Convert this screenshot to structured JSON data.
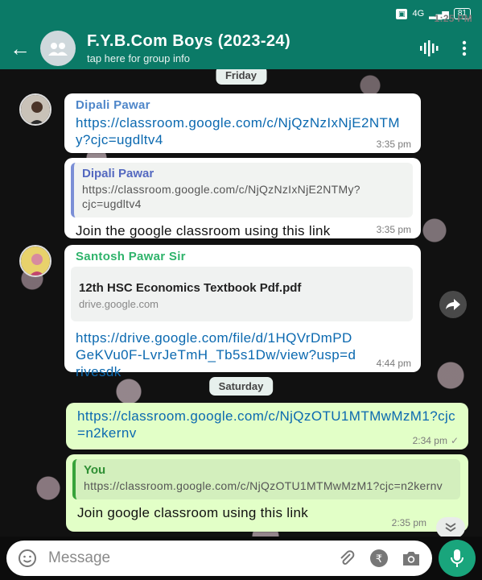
{
  "status_bar": {
    "time": "1:25 PM",
    "network": "4G",
    "battery": "81"
  },
  "header": {
    "title": "F.Y.B.Com Boys (2023-24)",
    "subtitle": "tap here for group info"
  },
  "dates": {
    "first": "Friday",
    "second": "Saturday"
  },
  "messages": [
    {
      "sender": "Dipali Pawar",
      "link": "https://classroom.google.com/c/NjQzNzIxNjE2NTMy?cjc=ugdltv4",
      "time": "3:35 pm"
    },
    {
      "quote_name": "Dipali Pawar",
      "quote_text": "https://classroom.google.com/c/NjQzNzIxNjE2NTMy?cjc=ugdltv4",
      "text": "Join the google classroom using this link",
      "time": "3:35 pm"
    },
    {
      "sender": "Santosh Pawar Sir",
      "doc_title": "12th HSC Economics Textbook Pdf.pdf",
      "doc_domain": "drive.google.com",
      "link": "https://drive.google.com/file/d/1HQVrDmPDGeKVu0F-LvrJeTmH_Tb5s1Dw/view?usp=drivesdk",
      "time": "4:44 pm"
    },
    {
      "link": "https://classroom.google.com/c/NjQzOTU1MTMwMzM1?cjc=n2kernv",
      "time": "2:34 pm",
      "ticks": "✓"
    },
    {
      "quote_name": "You",
      "quote_text": "https://classroom.google.com/c/NjQzOTU1MTMwMzM1?cjc=n2kernv",
      "text": "Join google classroom using this link",
      "time": "2:35 pm"
    }
  ],
  "composer": {
    "placeholder": "Message"
  },
  "colors": {
    "header": "#0b7a67",
    "outgoing": "#e2ffc7",
    "link": "#0b69b0",
    "mic": "#19a57c"
  }
}
